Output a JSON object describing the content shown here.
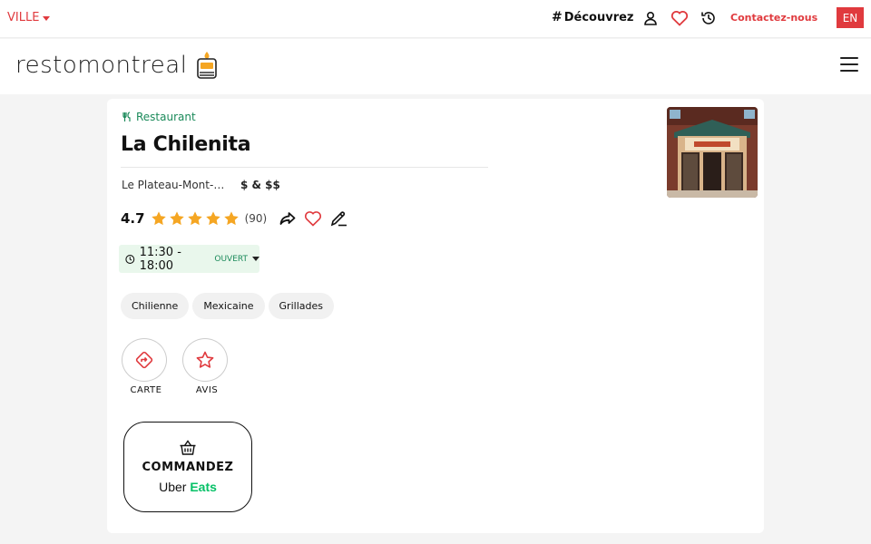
{
  "topbar": {
    "city_label": "VILLE",
    "discover_label": "Découvrez",
    "contact_label": "Contactez-nous",
    "lang_label": "EN"
  },
  "header": {
    "logo_text": "restomontreal"
  },
  "restaurant": {
    "category": "Restaurant",
    "name": "La Chilenita",
    "area": "Le Plateau-Mont-Royal",
    "price": "$ & $$",
    "rating": "4.7",
    "stars": 5,
    "review_count": "(90)",
    "hours": "11:30 - 18:00",
    "status": "Ouvert",
    "tags": [
      "Chilienne",
      "Mexicaine",
      "Grillades"
    ]
  },
  "actions": {
    "map_label": "CARTE",
    "reviews_label": "AVIS",
    "order_label": "COMMANDEZ",
    "uber_label": "Uber",
    "eats_label": "Eats"
  },
  "colors": {
    "accent": "#e03a3e",
    "green": "#1b8a5a",
    "star": "#f5a623"
  }
}
